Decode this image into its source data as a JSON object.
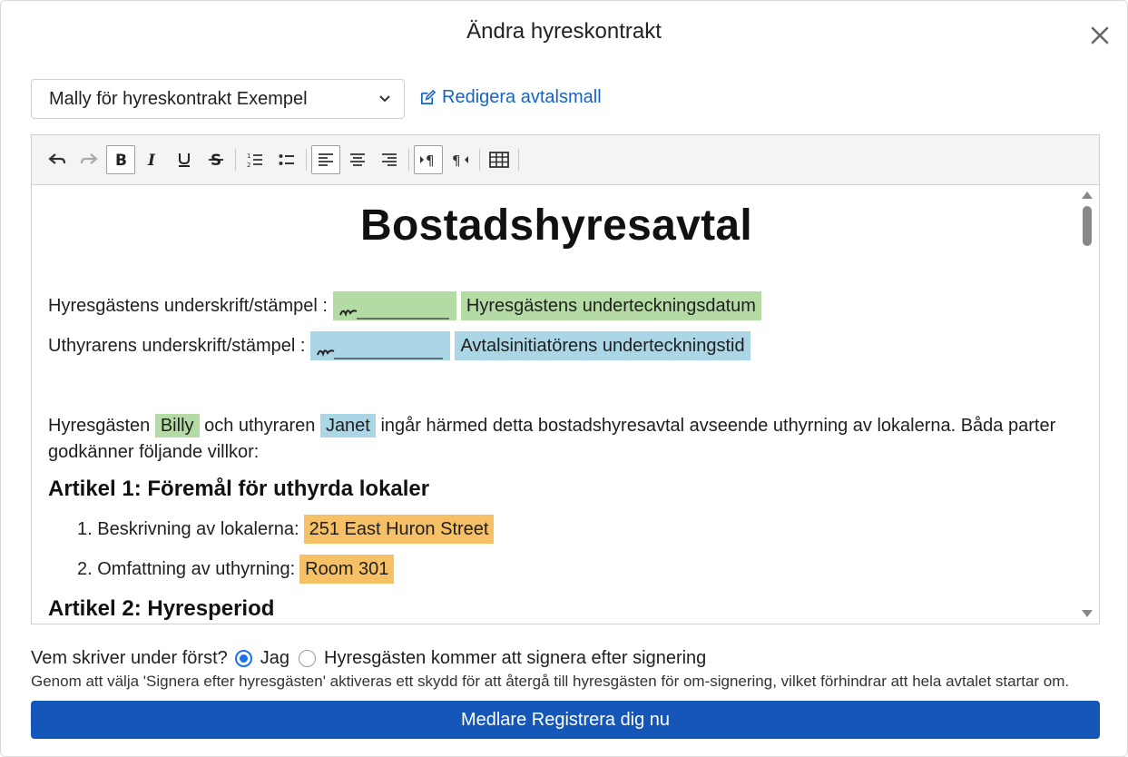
{
  "dialog": {
    "title": "Ändra hyreskontrakt",
    "close_icon": "close-icon"
  },
  "template": {
    "selected": "Mally för hyreskontrakt Exempel",
    "edit_label": "Redigera avtalsmall"
  },
  "toolbar": {
    "buttons": [
      "undo-icon",
      "redo-icon",
      "bold-icon",
      "italic-icon",
      "underline-icon",
      "strikethrough-icon",
      "ordered-list-icon",
      "bullet-list-icon",
      "align-left-icon",
      "align-center-icon",
      "align-right-icon",
      "ltr-icon",
      "rtl-icon",
      "table-icon"
    ],
    "active": [
      "bold-icon",
      "align-left-icon",
      "ltr-icon"
    ]
  },
  "document": {
    "title": "Bostadshyresavtal",
    "tenant_sig_label": "Hyresgästens underskrift/stämpel :",
    "tenant_date": "Hyresgästens undertecknings­datum",
    "landlord_sig_label": "Uthyrarens underskrift/stämpel :",
    "landlord_date": "Avtalsinitiatörens undertecknings­tid",
    "intro_part1": "Hyresgästen",
    "tenant_name": "Billy",
    "intro_part2": "och uthyraren",
    "landlord_name": "Janet",
    "intro_part3": "ingår härmed detta bostadshyresavtal avseende uthyrning av lokalerna. Båda parter godkänner följande villkor:",
    "article1": "Artikel 1: Föremål för uthyrda lokaler",
    "item1_label": "1. Beskrivning av lokalerna:",
    "item1_value": "251 East Huron Street",
    "item2_label": "2. Omfattning av uthyrning:",
    "item2_value": "Room 301",
    "article2": "Artikel 2: Hyresperiod"
  },
  "signing": {
    "question": "Vem skriver under först?",
    "option_me": "Jag",
    "option_tenant": "Hyresgästen kommer att signera efter signering",
    "selected": "option_me",
    "hint": "Genom att välja 'Signera efter hyresgästen' aktiveras ett skydd för att återgå till hyresgästen för om-signering, vilket förhindrar att hela avtalet startar om."
  },
  "submit_label": "Medlare Registrera dig nu",
  "colors": {
    "accent": "#1557b8",
    "tenant_highlight": "#b5dba5",
    "landlord_highlight": "#aad6e6",
    "field_highlight": "#f6c066"
  }
}
